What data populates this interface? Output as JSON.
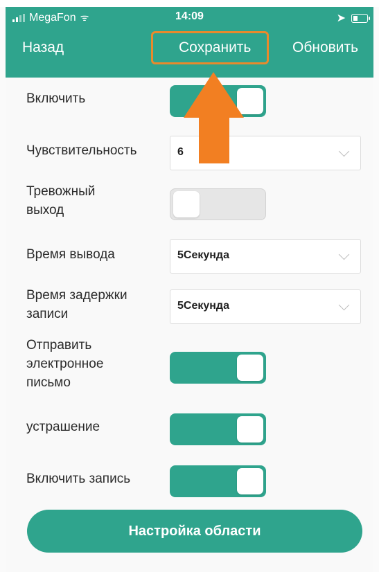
{
  "status_bar": {
    "carrier": "MegaFon",
    "time": "14:09"
  },
  "nav": {
    "back_label": "Назад",
    "save_label": "Сохранить",
    "refresh_label": "Обновить"
  },
  "settings": {
    "enable": {
      "label": "Включить",
      "state": "on"
    },
    "sensitivity": {
      "label": "Чувствительность",
      "value": "6"
    },
    "alarm_output": {
      "label_line1": "Тревожный",
      "label_line2": "выход",
      "state": "off"
    },
    "output_time": {
      "label": "Время вывода",
      "value": "5Секунда"
    },
    "record_delay": {
      "label_line1": "Время задержки",
      "label_line2": "записи",
      "value": "5Секунда"
    },
    "send_email": {
      "label_line1": "Отправить",
      "label_line2": "электронное",
      "label_line3": "письмо",
      "state": "on"
    },
    "deterrence": {
      "label": "устрашение",
      "state": "on"
    },
    "enable_recording": {
      "label": "Включить запись",
      "state": "on"
    }
  },
  "area_setup_button": "Настройка области",
  "colors": {
    "accent": "#2fa48d",
    "highlight": "#e98a2c",
    "arrow": "#f27f22"
  }
}
